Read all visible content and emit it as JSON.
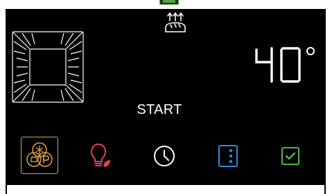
{
  "display": {
    "temperature_value": "40",
    "temperature_unit": "°",
    "start_label": "START"
  },
  "icons": {
    "oven": "oven-cavity-icon",
    "bread": "bread-proving-icon",
    "modes": "cooking-modes-icon",
    "eco": "eco-bulb-icon",
    "clock": "clock-icon",
    "options": "options-menu-icon",
    "confirm": "confirm-check-icon"
  },
  "colors": {
    "panel": "#000000",
    "text": "#ffffff",
    "modes_accent": "#e0a24a",
    "eco_accent": "#e8405a",
    "eco_leaf": "#d94a3a",
    "options_accent": "#2a8fd8",
    "confirm_accent": "#54b445"
  }
}
